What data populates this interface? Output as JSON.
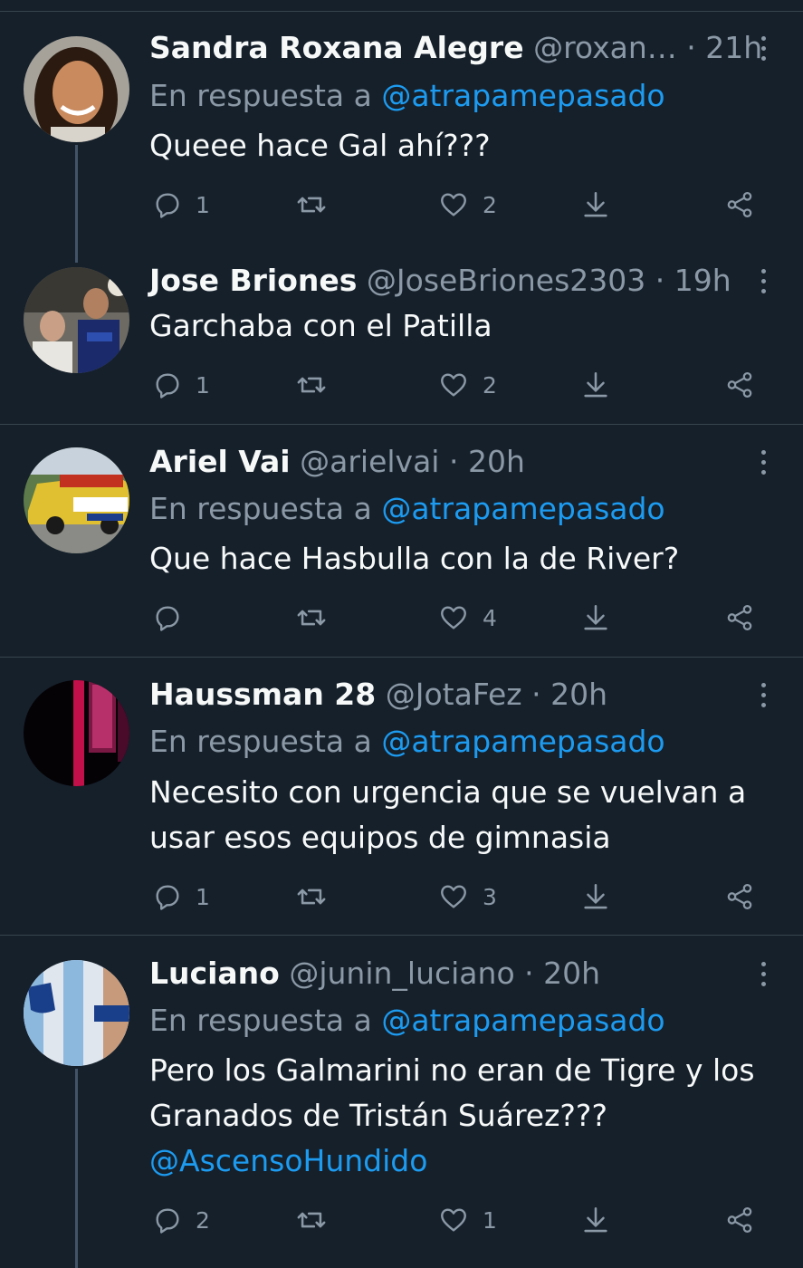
{
  "reply_prefix": "En respuesta a",
  "tweets": [
    {
      "name": "Sandra Roxana Alegre",
      "handle": "@roxan…",
      "time": " · 21h",
      "reply_to": "@atrapamepasado",
      "text": "Queee hace Gal ahí???",
      "replies": "1",
      "retweets": "",
      "likes": "2"
    },
    {
      "name": "Jose Briones",
      "handle": "@JoseBriones2303",
      "time": " · 19h",
      "text": "Garchaba con el Patilla",
      "replies": "1",
      "retweets": "",
      "likes": "2"
    },
    {
      "name": "Ariel Vai",
      "handle": "@arielvai",
      "time": " · 20h",
      "reply_to": "@atrapamepasado",
      "text": "Que hace Hasbulla con la de River?",
      "replies": "",
      "retweets": "",
      "likes": "4"
    },
    {
      "name": "Haussman 28",
      "handle": "@JotaFez",
      "time": " · 20h",
      "reply_to": "@atrapamepasado",
      "text_lines": [
        "Necesito con urgencia que se vuelvan a",
        "usar esos equipos de gimnasia"
      ],
      "replies": "1",
      "retweets": "",
      "likes": "3"
    },
    {
      "name": "Luciano",
      "handle": "@junin_luciano",
      "time": " · 20h",
      "reply_to": "@atrapamepasado",
      "text_lines": [
        "Pero los Galmarini no eran de Tigre y los",
        "Granados de Tristán Suárez???"
      ],
      "mention": "@AscensoHundido",
      "replies": "2",
      "retweets": "",
      "likes": "1"
    }
  ],
  "icons": {
    "reply": "reply-icon",
    "retweet": "retweet-icon",
    "like": "heart-icon",
    "download": "download-icon",
    "share": "share-icon",
    "more": "more-icon"
  },
  "colors": {
    "background": "#15202b",
    "text": "#f7f9f9",
    "secondary": "#8b98a5",
    "link": "#1d9bf0",
    "divider": "#38444d"
  }
}
